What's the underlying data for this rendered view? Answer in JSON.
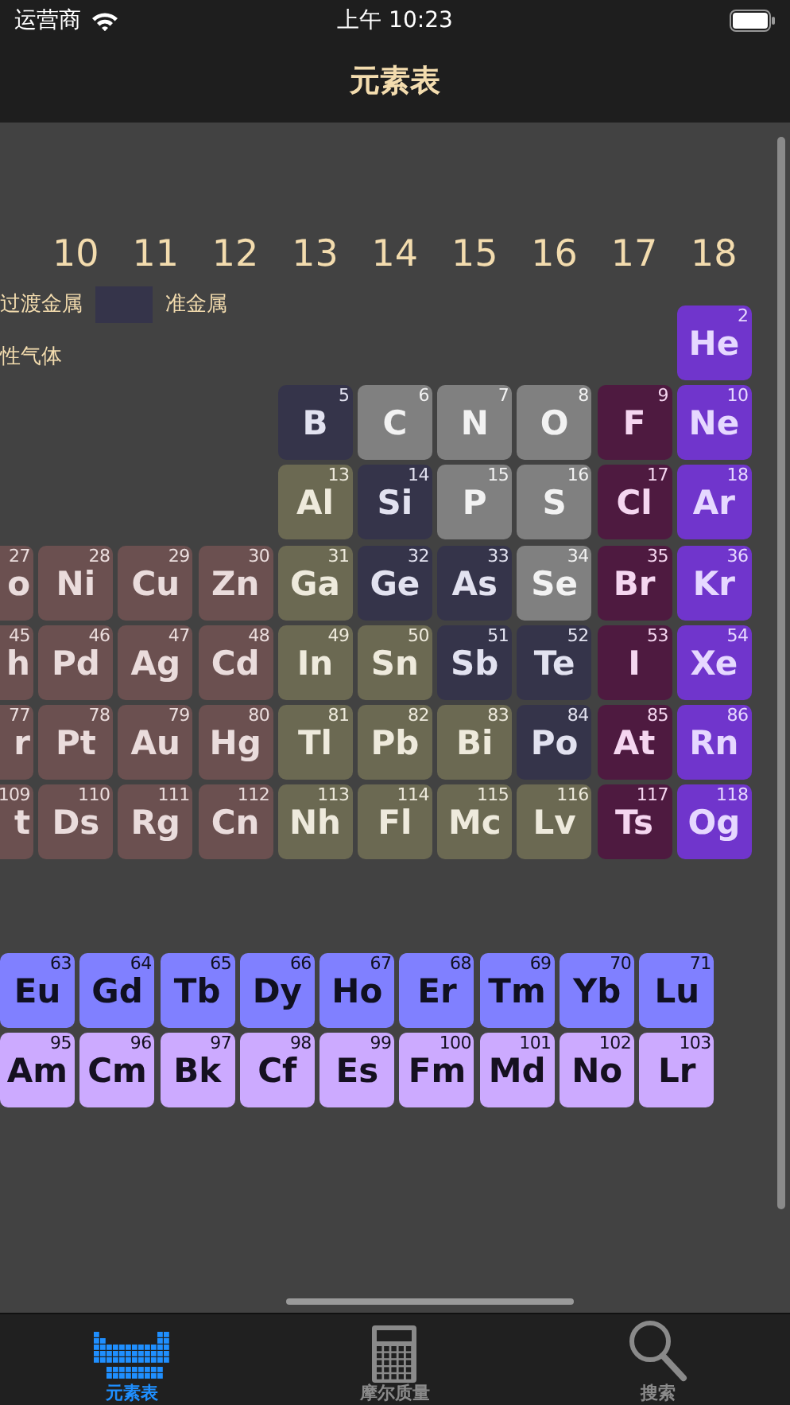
{
  "status_bar": {
    "carrier": "运营商",
    "time": "上午 10:23"
  },
  "nav": {
    "title": "元素表"
  },
  "group_numbers": [
    "10",
    "11",
    "12",
    "13",
    "14",
    "15",
    "16",
    "17",
    "18"
  ],
  "legend": [
    [
      {
        "label": "过渡金属"
      },
      {
        "label": "准金属",
        "color": "#35344a"
      }
    ],
    [
      {
        "label": "性气体"
      }
    ]
  ],
  "periods": [
    [
      {
        "number": "2",
        "symbol": "He",
        "kind": "noble"
      }
    ],
    [
      {
        "number": "5",
        "symbol": "B",
        "kind": "metalloid"
      },
      {
        "number": "6",
        "symbol": "C",
        "kind": "nonmetal"
      },
      {
        "number": "7",
        "symbol": "N",
        "kind": "nonmetal"
      },
      {
        "number": "8",
        "symbol": "O",
        "kind": "nonmetal"
      },
      {
        "number": "9",
        "symbol": "F",
        "kind": "halogen"
      },
      {
        "number": "10",
        "symbol": "Ne",
        "kind": "noble"
      }
    ],
    [
      {
        "number": "13",
        "symbol": "Al",
        "kind": "post"
      },
      {
        "number": "14",
        "symbol": "Si",
        "kind": "metalloid"
      },
      {
        "number": "15",
        "symbol": "P",
        "kind": "nonmetal"
      },
      {
        "number": "16",
        "symbol": "S",
        "kind": "nonmetal"
      },
      {
        "number": "17",
        "symbol": "Cl",
        "kind": "halogen"
      },
      {
        "number": "18",
        "symbol": "Ar",
        "kind": "noble"
      }
    ],
    [
      {
        "number": "27",
        "symbol": "o",
        "kind": "transition"
      },
      {
        "number": "28",
        "symbol": "Ni",
        "kind": "transition"
      },
      {
        "number": "29",
        "symbol": "Cu",
        "kind": "transition"
      },
      {
        "number": "30",
        "symbol": "Zn",
        "kind": "transition"
      },
      {
        "number": "31",
        "symbol": "Ga",
        "kind": "post"
      },
      {
        "number": "32",
        "symbol": "Ge",
        "kind": "metalloid"
      },
      {
        "number": "33",
        "symbol": "As",
        "kind": "metalloid"
      },
      {
        "number": "34",
        "symbol": "Se",
        "kind": "nonmetal"
      },
      {
        "number": "35",
        "symbol": "Br",
        "kind": "halogen"
      },
      {
        "number": "36",
        "symbol": "Kr",
        "kind": "noble"
      }
    ],
    [
      {
        "number": "45",
        "symbol": "h",
        "kind": "transition"
      },
      {
        "number": "46",
        "symbol": "Pd",
        "kind": "transition"
      },
      {
        "number": "47",
        "symbol": "Ag",
        "kind": "transition"
      },
      {
        "number": "48",
        "symbol": "Cd",
        "kind": "transition"
      },
      {
        "number": "49",
        "symbol": "In",
        "kind": "post"
      },
      {
        "number": "50",
        "symbol": "Sn",
        "kind": "post"
      },
      {
        "number": "51",
        "symbol": "Sb",
        "kind": "metalloid"
      },
      {
        "number": "52",
        "symbol": "Te",
        "kind": "metalloid"
      },
      {
        "number": "53",
        "symbol": "I",
        "kind": "halogen"
      },
      {
        "number": "54",
        "symbol": "Xe",
        "kind": "noble"
      }
    ],
    [
      {
        "number": "77",
        "symbol": "r",
        "kind": "transition"
      },
      {
        "number": "78",
        "symbol": "Pt",
        "kind": "transition"
      },
      {
        "number": "79",
        "symbol": "Au",
        "kind": "transition"
      },
      {
        "number": "80",
        "symbol": "Hg",
        "kind": "transition"
      },
      {
        "number": "81",
        "symbol": "Tl",
        "kind": "post"
      },
      {
        "number": "82",
        "symbol": "Pb",
        "kind": "post"
      },
      {
        "number": "83",
        "symbol": "Bi",
        "kind": "post"
      },
      {
        "number": "84",
        "symbol": "Po",
        "kind": "metalloid"
      },
      {
        "number": "85",
        "symbol": "At",
        "kind": "halogen"
      },
      {
        "number": "86",
        "symbol": "Rn",
        "kind": "noble"
      }
    ],
    [
      {
        "number": "109",
        "symbol": "t",
        "kind": "transition"
      },
      {
        "number": "110",
        "symbol": "Ds",
        "kind": "transition"
      },
      {
        "number": "111",
        "symbol": "Rg",
        "kind": "transition"
      },
      {
        "number": "112",
        "symbol": "Cn",
        "kind": "transition"
      },
      {
        "number": "113",
        "symbol": "Nh",
        "kind": "post"
      },
      {
        "number": "114",
        "symbol": "Fl",
        "kind": "post"
      },
      {
        "number": "115",
        "symbol": "Mc",
        "kind": "post"
      },
      {
        "number": "116",
        "symbol": "Lv",
        "kind": "post"
      },
      {
        "number": "117",
        "symbol": "Ts",
        "kind": "halogen"
      },
      {
        "number": "118",
        "symbol": "Og",
        "kind": "noble"
      }
    ]
  ],
  "f_block": [
    [
      {
        "number": "63",
        "symbol": "Eu",
        "kind": "lanthanide"
      },
      {
        "number": "64",
        "symbol": "Gd",
        "kind": "lanthanide"
      },
      {
        "number": "65",
        "symbol": "Tb",
        "kind": "lanthanide"
      },
      {
        "number": "66",
        "symbol": "Dy",
        "kind": "lanthanide"
      },
      {
        "number": "67",
        "symbol": "Ho",
        "kind": "lanthanide"
      },
      {
        "number": "68",
        "symbol": "Er",
        "kind": "lanthanide"
      },
      {
        "number": "69",
        "symbol": "Tm",
        "kind": "lanthanide"
      },
      {
        "number": "70",
        "symbol": "Yb",
        "kind": "lanthanide"
      },
      {
        "number": "71",
        "symbol": "Lu",
        "kind": "lanthanide"
      }
    ],
    [
      {
        "number": "95",
        "symbol": "Am",
        "kind": "actinide"
      },
      {
        "number": "96",
        "symbol": "Cm",
        "kind": "actinide"
      },
      {
        "number": "97",
        "symbol": "Bk",
        "kind": "actinide"
      },
      {
        "number": "98",
        "symbol": "Cf",
        "kind": "actinide"
      },
      {
        "number": "99",
        "symbol": "Es",
        "kind": "actinide"
      },
      {
        "number": "100",
        "symbol": "Fm",
        "kind": "actinide"
      },
      {
        "number": "101",
        "symbol": "Md",
        "kind": "actinide"
      },
      {
        "number": "102",
        "symbol": "No",
        "kind": "actinide"
      },
      {
        "number": "103",
        "symbol": "Lr",
        "kind": "actinide"
      }
    ]
  ],
  "tabs": [
    {
      "label": "元素表",
      "selected": true
    },
    {
      "label": "摩尔质量",
      "selected": false
    },
    {
      "label": "搜索",
      "selected": false
    }
  ]
}
